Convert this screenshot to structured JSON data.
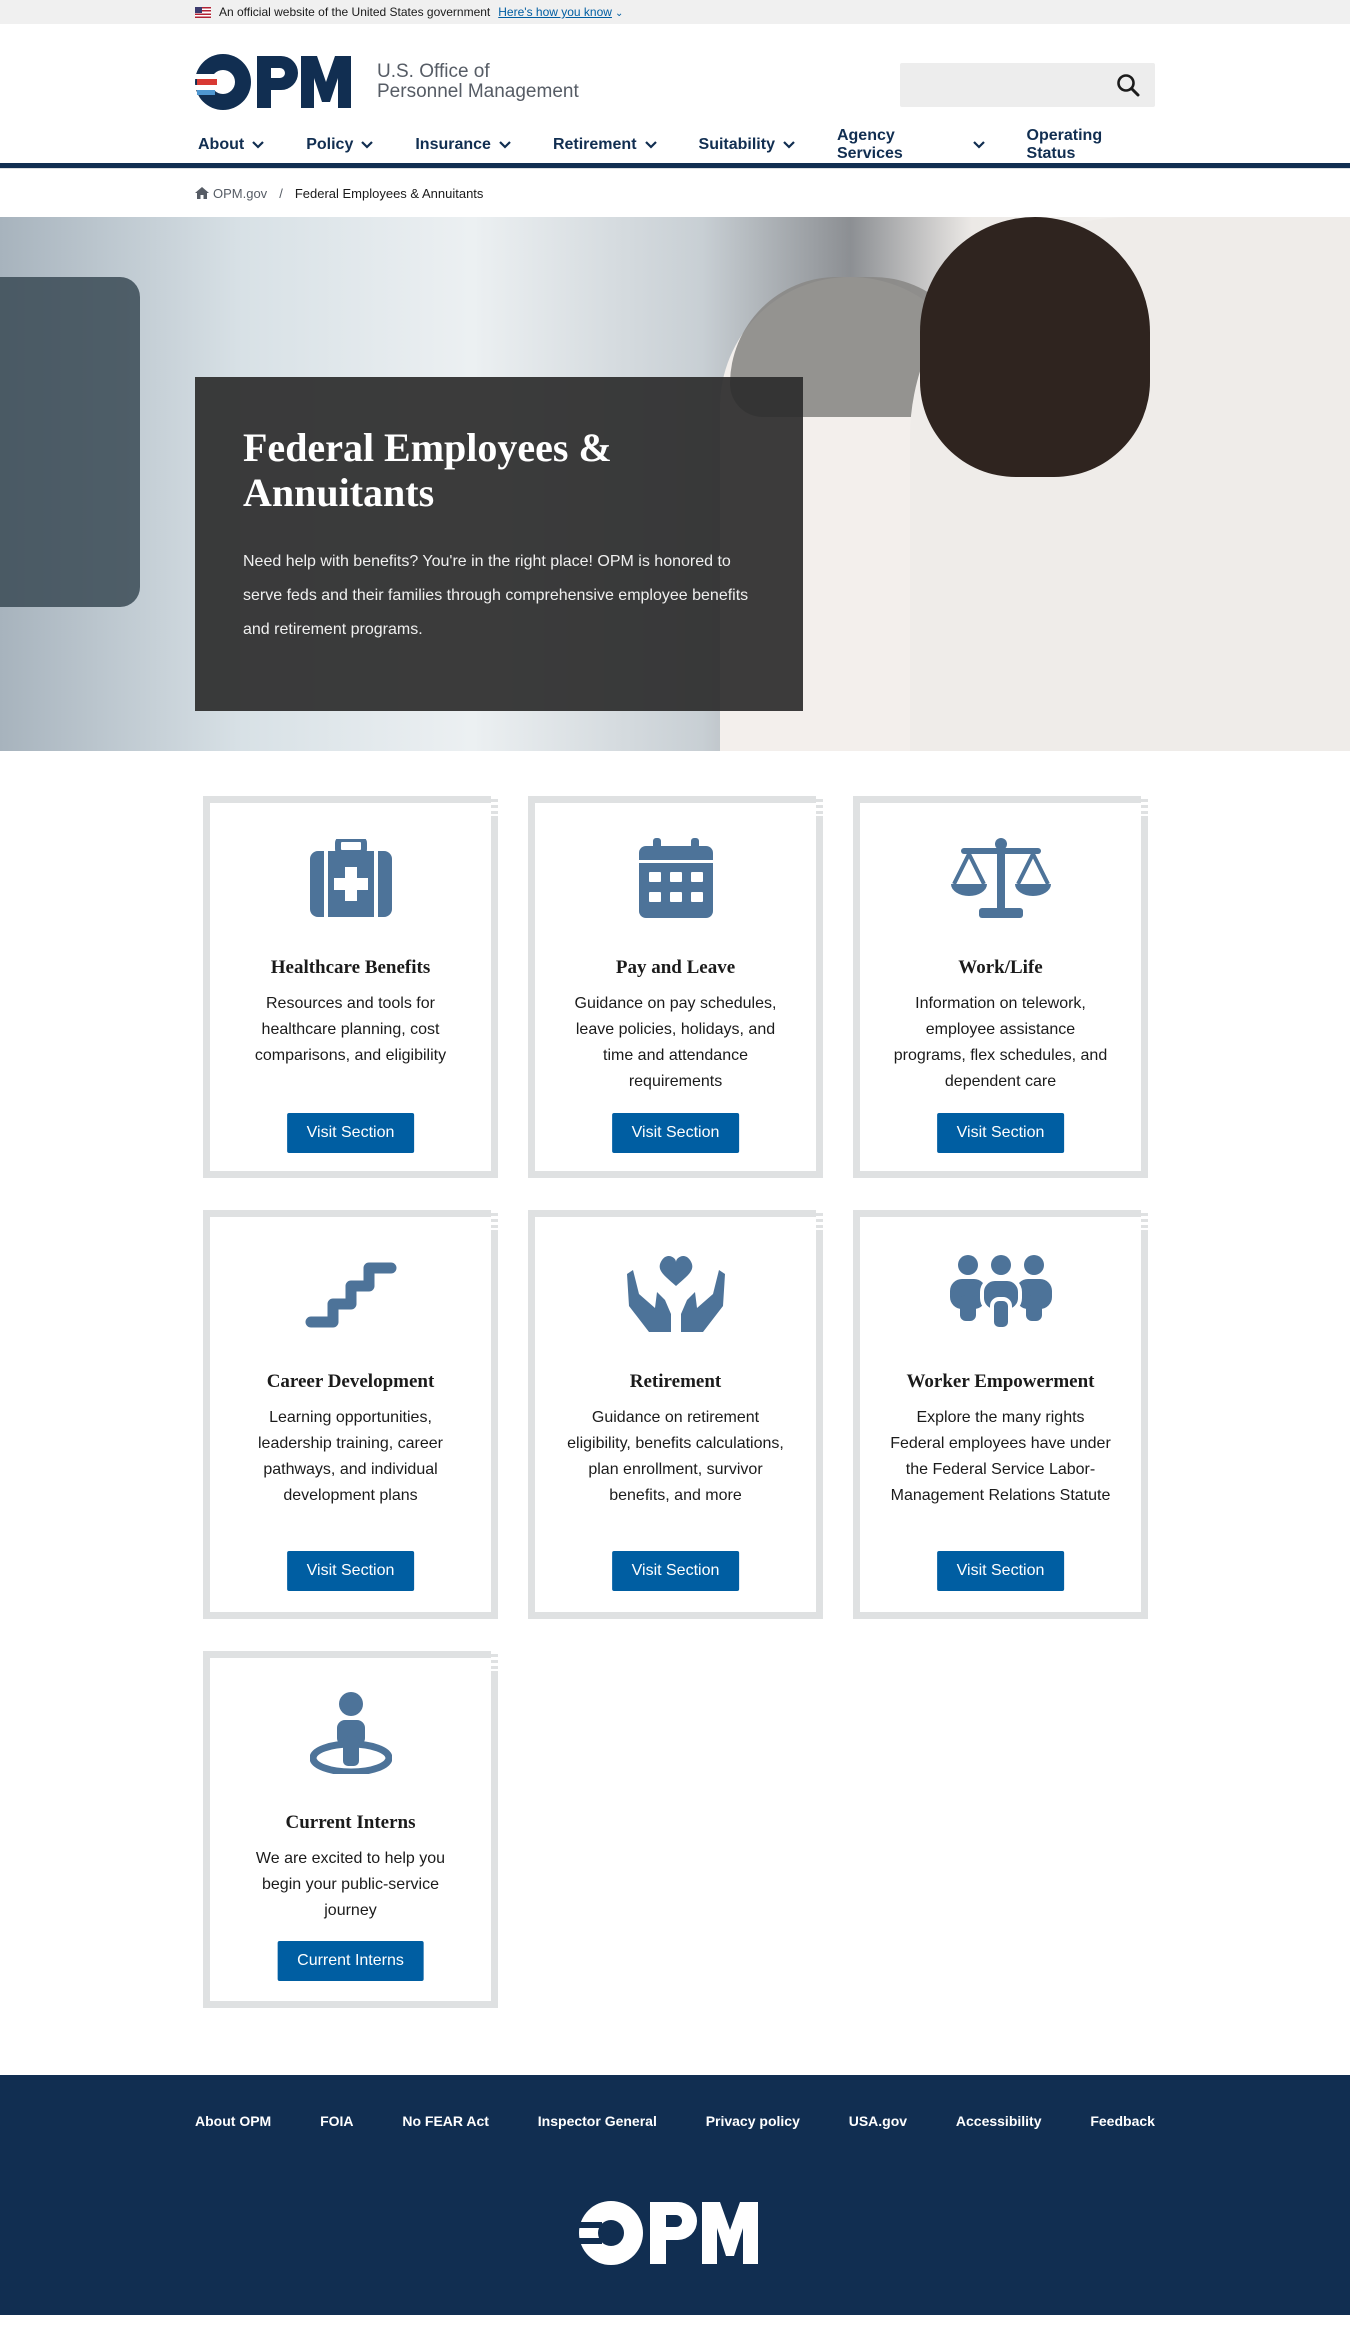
{
  "gov_banner": {
    "text": "An official website of the United States government",
    "link_text": "Here's how you know"
  },
  "header": {
    "logo_line1": "U.S. Office of",
    "logo_line2": "Personnel Management",
    "search_placeholder": ""
  },
  "nav": {
    "items": [
      {
        "label": "About",
        "dropdown": true
      },
      {
        "label": "Policy",
        "dropdown": true
      },
      {
        "label": "Insurance",
        "dropdown": true
      },
      {
        "label": "Retirement",
        "dropdown": true
      },
      {
        "label": "Suitability",
        "dropdown": true
      },
      {
        "label": "Agency Services",
        "dropdown": true
      },
      {
        "label": "Operating Status",
        "dropdown": false
      }
    ]
  },
  "breadcrumb": {
    "home": "OPM.gov",
    "separator": "/",
    "current": "Federal Employees & Annuitants"
  },
  "hero": {
    "title": "Federal Employees & Annuitants",
    "text": "Need help with benefits? You're in the right place! OPM is honored to serve feds and their families through comprehensive employee benefits and retirement programs."
  },
  "cards": [
    {
      "icon": "medical-kit-icon",
      "title": "Healthcare Benefits",
      "text": "Resources and tools for healthcare planning, cost comparisons, and eligibility",
      "button": "Visit Section"
    },
    {
      "icon": "calendar-icon",
      "title": "Pay and Leave",
      "text": "Guidance on pay schedules, leave policies, holidays, and time and attendance requirements",
      "button": "Visit Section"
    },
    {
      "icon": "scale-icon",
      "title": "Work/Life",
      "text": "Information on telework, employee assistance programs, flex schedules, and dependent care",
      "button": "Visit Section"
    },
    {
      "icon": "stairs-icon",
      "title": "Career Development",
      "text": "Learning opportunities, leadership training, career pathways, and individual development plans",
      "button": "Visit Section"
    },
    {
      "icon": "hands-heart-icon",
      "title": "Retirement",
      "text": "Guidance on retirement eligibility, benefits calculations, plan enrollment, survivor benefits, and more",
      "button": "Visit Section"
    },
    {
      "icon": "group-icon",
      "title": "Worker Empowerment",
      "text": "Explore the many rights Federal employees have under the Federal Service Labor-Management Relations Statute",
      "button": "Visit Section"
    },
    {
      "icon": "person-location-icon",
      "title": "Current Interns",
      "text": "We are excited to help you begin your public-service journey",
      "button": "Current Interns"
    }
  ],
  "footer": {
    "links": [
      "About OPM",
      "FOIA",
      "No FEAR Act",
      "Inspector General",
      "Privacy policy",
      "USA.gov",
      "Accessibility",
      "Feedback"
    ]
  },
  "colors": {
    "navy": "#112e51",
    "button_blue": "#005ea2",
    "icon_blue": "#4d7399",
    "card_border": "#dfe1e2"
  }
}
